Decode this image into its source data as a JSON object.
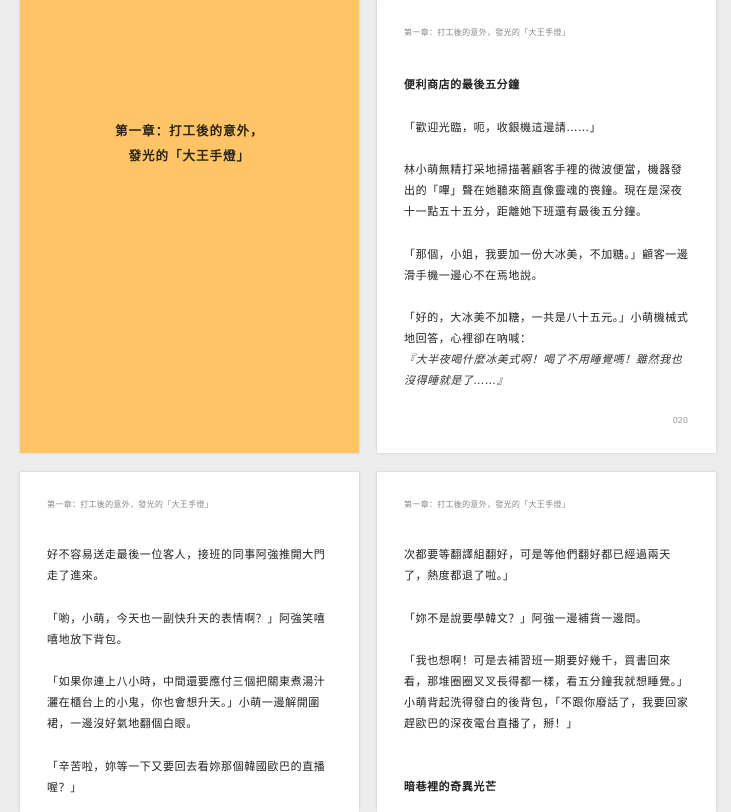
{
  "pages": [
    {
      "chapter_title_lines": [
        "第一章：打工後的意外，",
        "發光的「大王手燈」"
      ],
      "background": "#ffc466"
    },
    {
      "running_head": "第一章：打工後的意外，發光的「大王手燈」",
      "section_heading": "便利商店的最後五分鐘",
      "paragraphs": [
        "「歡迎光臨，呃，收銀機這邊請……」",
        "林小萌無精打采地掃描著顧客手裡的微波便當，機器發出的「嗶」聲在她聽來簡直像靈魂的喪鐘。現在是深夜十一點五十五分，距離她下班還有最後五分鐘。",
        "「那個，小姐，我要加一份大冰美，不加糖。」顧客一邊滑手機一邊心不在焉地說。",
        "「好的，大冰美不加糖，一共是八十五元。」小萌機械式地回答，心裡卻在吶喊："
      ],
      "thought": "『大半夜喝什麼冰美式啊！喝了不用睡覺嗎！雖然我也沒得睡就是了……』",
      "page_number": "020"
    },
    {
      "running_head": "第一章：打工後的意外，發光的「大王手燈」",
      "paragraphs": [
        "好不容易送走最後一位客人，接班的同事阿強推開大門走了進來。",
        "「喲，小萌，今天也一副快升天的表情啊？」阿強笑嘻嘻地放下背包。",
        "「如果你連上八小時，中間還要應付三個把關東煮湯汁灑在櫃台上的小鬼，你也會想升天。」小萌一邊解開圍裙，一邊沒好氣地翻個白眼。",
        "「辛苦啦，妳等一下又要回去看妳那個韓國歐巴的直播喔？」"
      ]
    },
    {
      "running_head": "第一章：打工後的意外，發光的「大王手燈」",
      "paragraphs": [
        "次都要等翻譯組翻好，可是等他們翻好都已經過兩天了，熱度都退了啦。」",
        "「妳不是說要學韓文？」阿強一邊補貨一邊問。",
        "「我也想啊！可是去補習班一期要好幾千，買書回來看，那堆圈圈叉叉長得都一樣，看五分鐘我就想睡覺。」小萌背起洗得發白的後背包，「不跟你廢話了，我要回家趕歐巴的深夜電台直播了，掰！」"
      ],
      "section_heading": "暗巷裡的奇異光芒"
    }
  ]
}
